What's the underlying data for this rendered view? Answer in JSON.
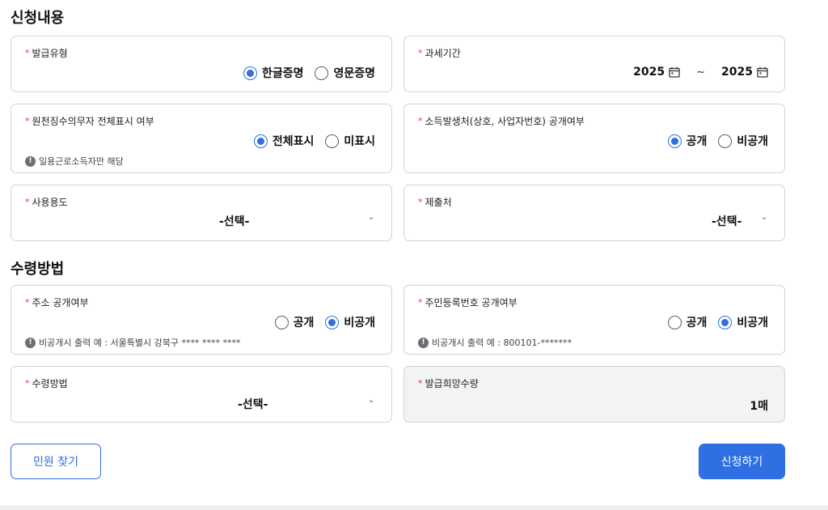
{
  "sections": {
    "application": "신청내용",
    "receipt": "수령방법"
  },
  "required_mark": "*",
  "issue_type": {
    "label": "발급유형",
    "options": [
      "한글증명",
      "영문증명"
    ],
    "selected": "한글증명"
  },
  "tax_period": {
    "label": "과세기간",
    "from": "2025",
    "to": "2025",
    "separator": "~"
  },
  "withholding": {
    "label": "원천징수의무자 전체표시 여부",
    "options": [
      "전체표시",
      "미표시"
    ],
    "selected": "전체표시",
    "note": "일용근로소득자만 해당"
  },
  "income_source": {
    "label": "소득발생처(상호, 사업자번호) 공개여부",
    "options": [
      "공개",
      "비공개"
    ],
    "selected": "공개"
  },
  "usage": {
    "label": "사용용도",
    "value": "-선택-"
  },
  "submit_to": {
    "label": "제출처",
    "value": "-선택-"
  },
  "address_public": {
    "label": "주소 공개여부",
    "options": [
      "공개",
      "비공개"
    ],
    "selected": "비공개",
    "note": "비공개시 출력 예 : 서울특별시 강북구 **** **** ****"
  },
  "rrn_public": {
    "label": "주민등록번호 공개여부",
    "options": [
      "공개",
      "비공개"
    ],
    "selected": "비공개",
    "note": "비공개시 출력 예 : 800101-*******"
  },
  "receipt_method": {
    "label": "수령방법",
    "value": "-선택-"
  },
  "issue_quantity": {
    "label": "발급희망수량",
    "value": "1매"
  },
  "buttons": {
    "find": "민원 찾기",
    "apply": "신청하기"
  },
  "icons": {
    "info": "!",
    "chevron": "⌄"
  },
  "colors": {
    "accent": "#2f6fde",
    "required": "#e03a3a",
    "border": "#cfd4da",
    "disabled_bg": "#f2f3f5"
  }
}
